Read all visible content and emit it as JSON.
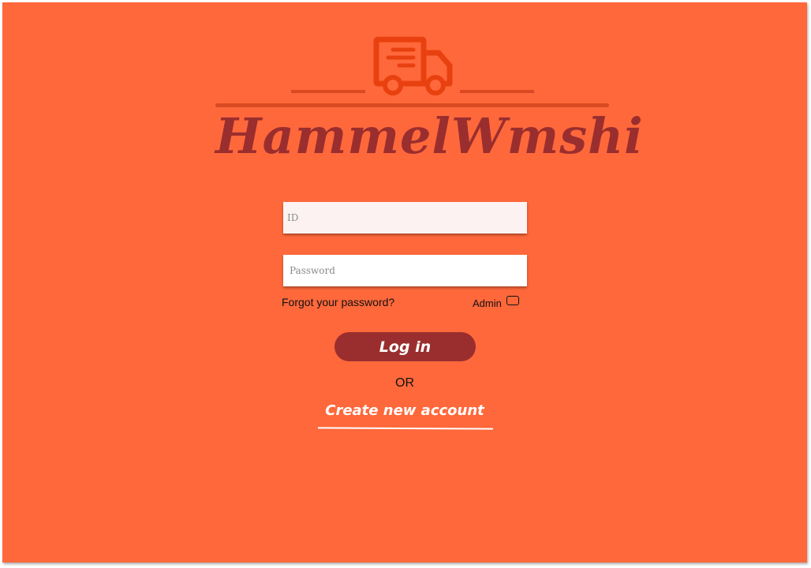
{
  "brand": {
    "name": "HammelWmshi",
    "logo_icon": "delivery-truck-icon",
    "accent_color": "#ff683b",
    "brand_color": "#9a2e2e",
    "logo_color": "#e8410f"
  },
  "login_form": {
    "id_placeholder": "ID",
    "password_placeholder": "Password",
    "forgot_password_label": "Forgot your password?",
    "admin_label": "Admin",
    "admin_checked": false,
    "login_button_label": "Log in",
    "or_label": "OR",
    "create_account_label": "Create new account"
  }
}
